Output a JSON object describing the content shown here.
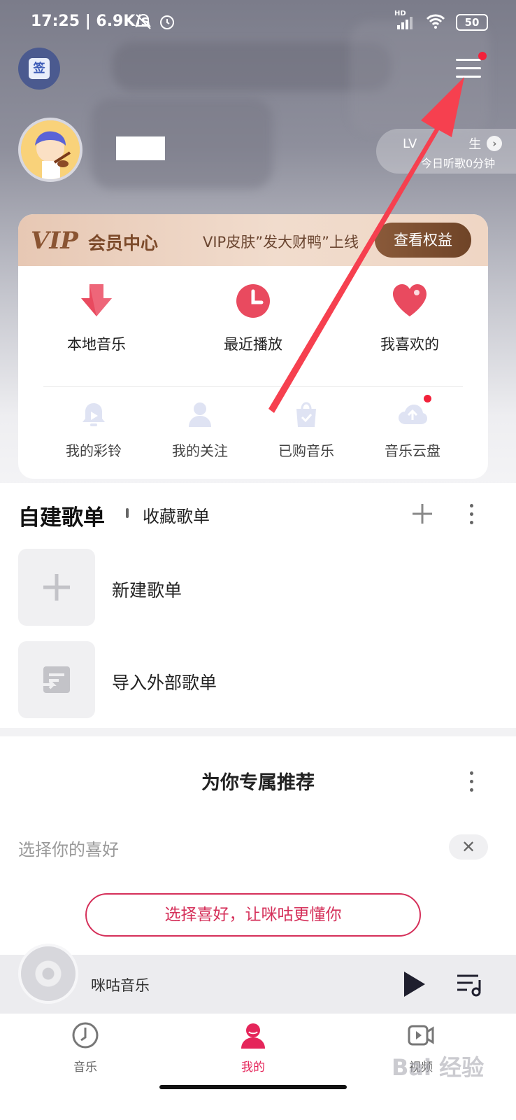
{
  "status_bar": {
    "time": "17:25 | 6.9K/s",
    "network": "HD",
    "battery": "50"
  },
  "top": {
    "sign_label": "签"
  },
  "profile": {
    "level_text": "LV",
    "level_title_tail": "生",
    "listen_today": "今日听歌0分钟"
  },
  "vip": {
    "logo": "VIP",
    "center_label": "会员中心",
    "promo": "VIP皮肤”发大财鸭”上线",
    "button": "查看权益"
  },
  "shortcuts_primary": [
    {
      "label": "本地音乐",
      "icon": "download-arrow-icon"
    },
    {
      "label": "最近播放",
      "icon": "clock-icon"
    },
    {
      "label": "我喜欢的",
      "icon": "heart-icon"
    }
  ],
  "shortcuts_secondary": [
    {
      "label": "我的彩铃",
      "icon": "ringtone-bell-icon"
    },
    {
      "label": "我的关注",
      "icon": "person-icon"
    },
    {
      "label": "已购音乐",
      "icon": "shopping-bag-icon"
    },
    {
      "label": "音乐云盘",
      "icon": "cloud-upload-icon"
    }
  ],
  "playlists": {
    "tab_active": "自建歌单",
    "tab_other": "收藏歌单",
    "items": [
      {
        "label": "新建歌单",
        "icon": "plus-icon"
      },
      {
        "label": "导入外部歌单",
        "icon": "import-icon"
      }
    ]
  },
  "recommend": {
    "title": "为你专属推荐",
    "preference_prompt": "选择你的喜好",
    "close": "✕",
    "cta": "选择喜好，让咪咕更懂你"
  },
  "player": {
    "title": "咪咕音乐"
  },
  "nav": {
    "items": [
      {
        "label": "音乐",
        "icon": "music-disc-icon",
        "active": false
      },
      {
        "label": "我的",
        "icon": "user-icon",
        "active": true
      },
      {
        "label": "视频",
        "icon": "video-icon",
        "active": false
      }
    ]
  },
  "watermark": "Bai 经验",
  "colors": {
    "accent": "#e5255a",
    "vip_brown": "#7c4a2a",
    "annotation_arrow": "#f6404f"
  }
}
